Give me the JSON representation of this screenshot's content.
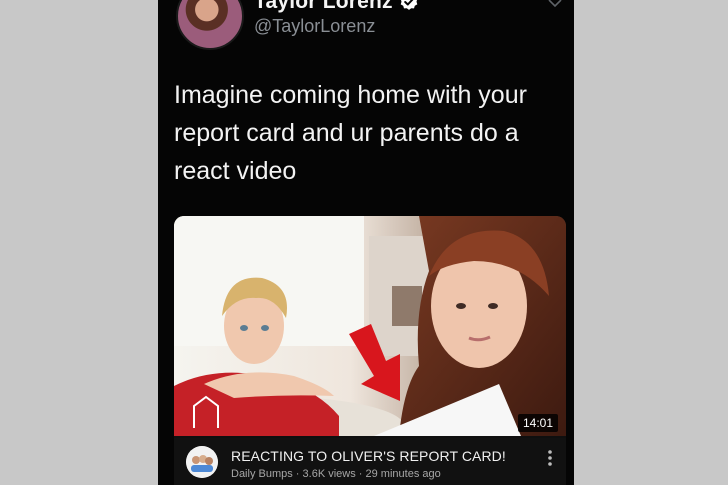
{
  "tweet": {
    "display_name": "Taylor Lorenz",
    "handle": "@TaylorLorenz",
    "text": "Imagine coming home with your\nreport card and ur parents do a\nreact video"
  },
  "video": {
    "duration": "14:01",
    "title": "REACTING TO OLIVER'S REPORT CARD!",
    "channel": "Daily Bumps",
    "views": "3.6K views",
    "posted": "29 minutes ago",
    "separator": " · "
  },
  "colors": {
    "background": "#c8c8c8",
    "phone": "#050505",
    "verified_badge": "#ffffff",
    "arrow": "#d8161d"
  },
  "icons": {
    "verified": "verified-badge-icon",
    "chevron": "chevron-down-icon",
    "more": "more-vertical-icon",
    "arrow": "red-arrow-icon"
  }
}
